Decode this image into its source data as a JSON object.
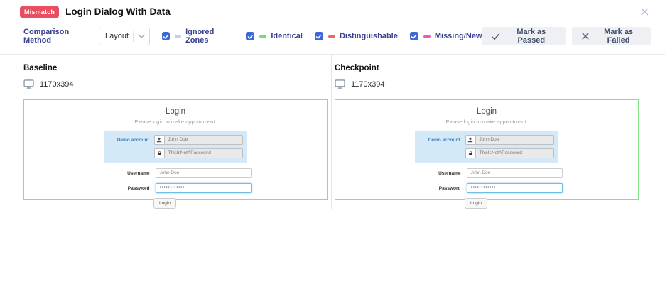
{
  "header": {
    "badge": "Mismatch",
    "title": "Login Dialog With Data"
  },
  "toolbar": {
    "comparison_label": "Comparison Method",
    "comparison_value": "Layout",
    "legend": [
      {
        "label": "Ignored Zones",
        "checked": true,
        "color": "#c9cdee"
      },
      {
        "label": "Identical",
        "checked": true,
        "color": "#6edf6e"
      },
      {
        "label": "Distinguishable",
        "checked": true,
        "color": "#f26460"
      },
      {
        "label": "Missing/New",
        "checked": true,
        "color": "#ee59b2"
      }
    ],
    "mark_passed_label": "Mark as Passed",
    "mark_failed_label": "Mark as Failed"
  },
  "panels": [
    {
      "name": "Baseline",
      "resolution": "1170x394"
    },
    {
      "name": "Checkpoint",
      "resolution": "1170x394"
    }
  ],
  "screenshot": {
    "title": "Login",
    "subtitle": "Please login to make appointment.",
    "demo_label": "Demo account",
    "demo_username": "John Doe",
    "demo_password": "ThisIsNotAPassword",
    "username_label": "Username",
    "username_value": "John Doe",
    "password_label": "Password",
    "password_value": "••••••••••••",
    "login_label": "Login"
  },
  "colors": {
    "badge_bg": "#e94e60",
    "label_navy": "#35408f",
    "checkbox_blue": "#3d68d8",
    "screenshot_border_green": "#84e384",
    "button_bg": "#eef0f4",
    "demo_panel_blue": "#d4e9f7",
    "focus_border_blue": "#6fbde8"
  }
}
